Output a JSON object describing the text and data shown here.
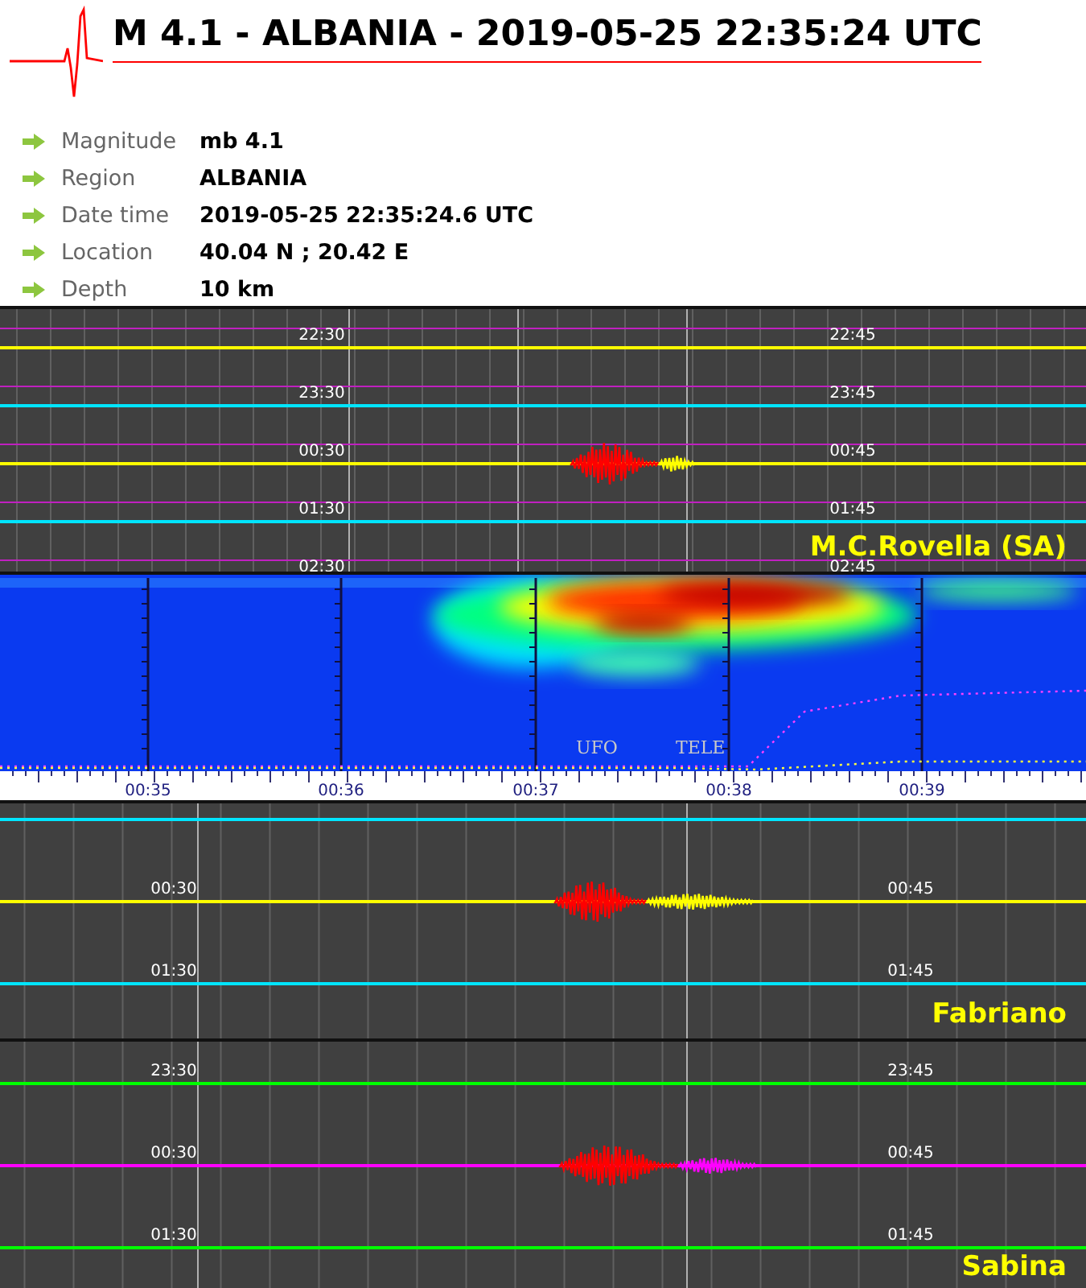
{
  "title": "M 4.1 - ALBANIA - 2019-05-25 22:35:24 UTC",
  "details": [
    {
      "label": "Magnitude",
      "value": "mb 4.1"
    },
    {
      "label": "Region",
      "value": "ALBANIA"
    },
    {
      "label": "Date time",
      "value": "2019-05-25 22:35:24.6 UTC"
    },
    {
      "label": "Location",
      "value": "40.04 N ; 20.42 E"
    },
    {
      "label": "Depth",
      "value": "10 km"
    }
  ],
  "helicorders": [
    {
      "station": "M.C.Rovella (SA)",
      "rows": [
        {
          "left": "22:30",
          "right": "22:45",
          "color": "#ffff00",
          "event": false
        },
        {
          "left": "23:30",
          "right": "23:45",
          "color": "#00e5ff",
          "event": false
        },
        {
          "left": "00:30",
          "right": "00:45",
          "color": "#ffff00",
          "event": true
        },
        {
          "left": "01:30",
          "right": "01:45",
          "color": "#00e5ff",
          "event": false
        },
        {
          "left": "02:30",
          "right": "02:45"
        }
      ]
    },
    {
      "station": "Fabriano",
      "rows": [
        {
          "color": "#00e5ff",
          "event": false
        },
        {
          "left": "00:30",
          "right": "00:45",
          "color": "#ffff00",
          "event": true
        },
        {
          "left": "01:30",
          "right": "01:45",
          "color": "#00e5ff",
          "event": false
        }
      ]
    },
    {
      "station": "Sabina",
      "rows": [
        {
          "left": "23:30",
          "right": "23:45",
          "color": "#00ff00",
          "event": false
        },
        {
          "left": "00:30",
          "right": "00:45",
          "color": "#ff00ff",
          "event": true
        },
        {
          "left": "01:30",
          "right": "01:45",
          "color": "#00ff00",
          "event": false
        }
      ]
    }
  ],
  "spectrogram": {
    "ticks": [
      "00:35",
      "00:36",
      "00:37",
      "00:38",
      "00:39"
    ],
    "markers": [
      "UFO",
      "TELE"
    ]
  }
}
